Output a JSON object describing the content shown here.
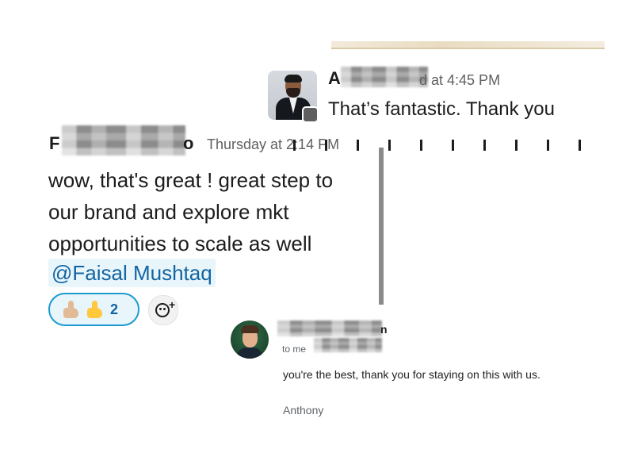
{
  "top_message": {
    "name_initial": "A",
    "time_text": "d at 4:45 PM",
    "text": "That’s fantastic. Thank you"
  },
  "left_message": {
    "name_initial": "F",
    "name_tail": "o",
    "time_text": "Thursday at 2:14 PM",
    "lines": [
      "wow, that's great ! great step to",
      "our brand and explore mkt",
      "opportunities to scale as well"
    ],
    "mention": "@Faisal Mushtaq",
    "reaction": {
      "count": "2",
      "emojis": [
        "thumbs-up-light-icon",
        "thumbs-up-icon"
      ]
    },
    "add_reaction_icon": "add-reaction-icon"
  },
  "email": {
    "name_tail": "n",
    "to_line": "to me",
    "text": "you're the best, thank you for staying on this with us.",
    "signature": "Anthony"
  },
  "colors": {
    "mention_blue": "#1264a3",
    "mention_bg": "#e8f5fa",
    "reaction_border": "#1d9bd1"
  }
}
